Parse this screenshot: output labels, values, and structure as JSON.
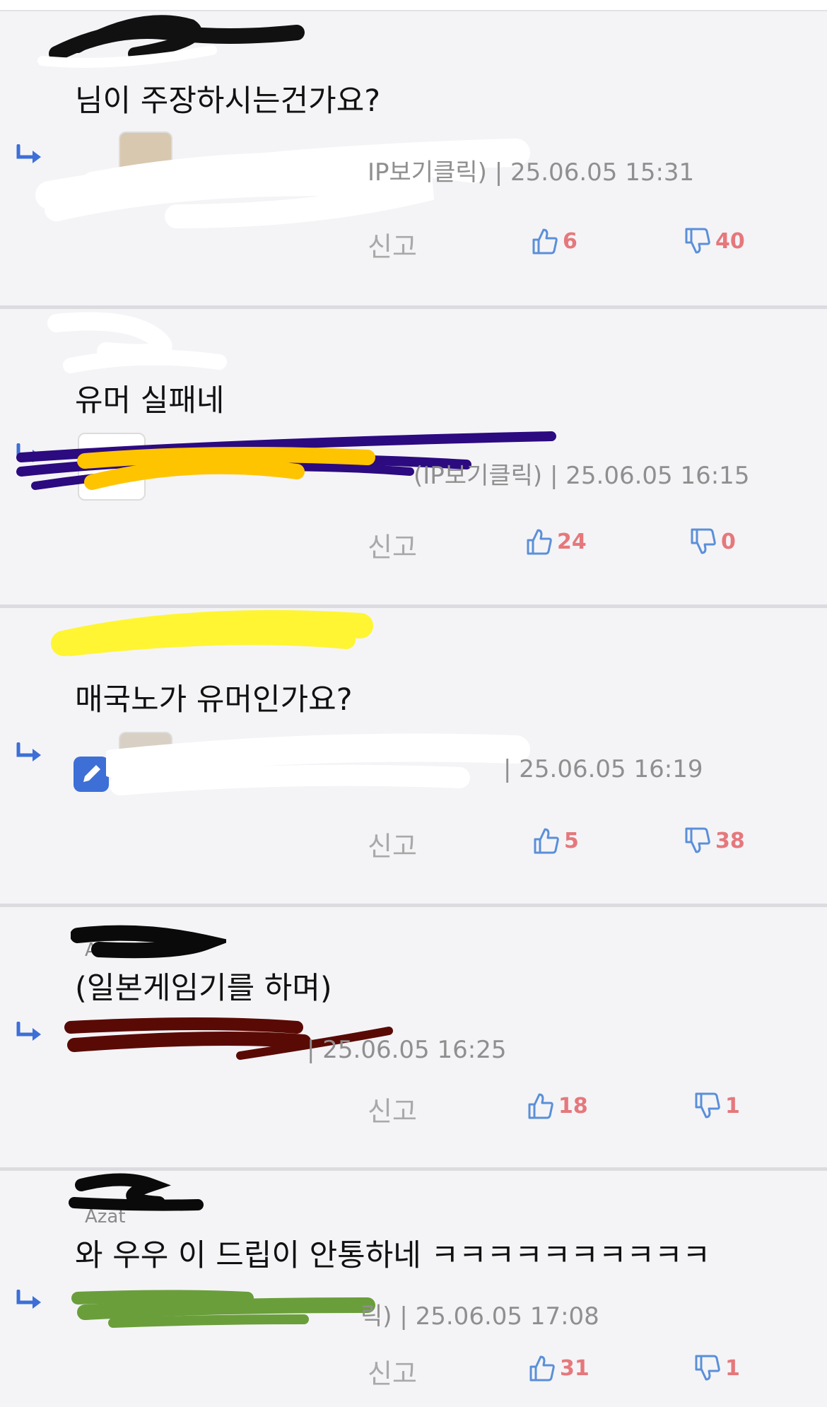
{
  "colors": {
    "accent": "#3d6fd6",
    "vote_count": "#e5787c",
    "thumb_icon": "#5b8fd8",
    "meta_text": "#8f8f8f"
  },
  "comments": [
    {
      "text": "님이 주장하시는건가요?",
      "meta": "IP보기클릭) | 25.06.05 15:31",
      "report": "신고",
      "up": "6",
      "down": "40"
    },
    {
      "text": "유머 실패네",
      "meta": "(IP보기클릭) | 25.06.05 16:15",
      "report": "신고",
      "up": "24",
      "down": "0"
    },
    {
      "text": "매국노가 유머인가요?",
      "meta": "| 25.06.05 16:19",
      "report": "신고",
      "up": "5",
      "down": "38"
    },
    {
      "nick_fragment": "Az",
      "text": "(일본게임기를 하며)",
      "meta": "| 25.06.05 16:25",
      "report": "신고",
      "up": "18",
      "down": "1"
    },
    {
      "nick_fragment": "Azat",
      "text": "와 우우 이 드립이 안통하네 ㅋㅋㅋㅋㅋㅋㅋㅋㅋㅋ",
      "meta": "릭) | 25.06.05 17:08",
      "report": "신고",
      "up": "31",
      "down": "1"
    }
  ]
}
